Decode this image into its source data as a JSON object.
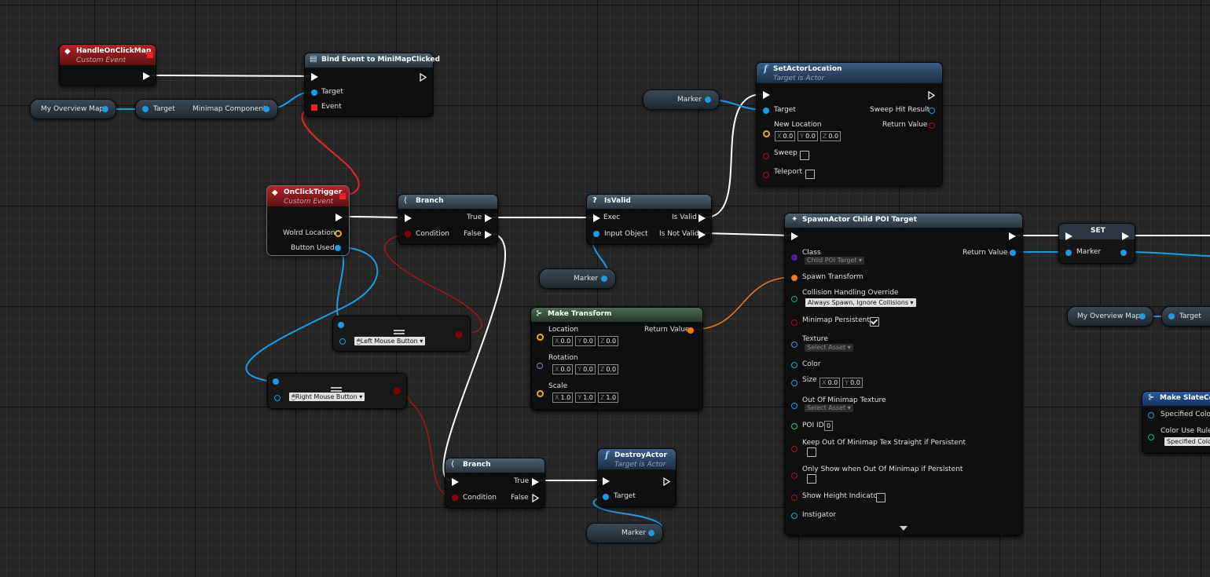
{
  "colors": {
    "exec": "#ffffff",
    "object": "#1e9be0",
    "boolean": "#a21818",
    "vector": "#e7b400",
    "transform": "#ef7a1a",
    "event_header": "#b62226",
    "function_header": "#3b5f86"
  },
  "handle_on_click": {
    "title": "HandleOnClickMap",
    "subtitle": "Custom Event"
  },
  "bind_event": {
    "title": "Bind Event to MiniMapClicked",
    "target": "Target",
    "event": "Event"
  },
  "overview_map_var": {
    "label": "My Overview Map"
  },
  "minimap_getter": {
    "target": "Target",
    "output": "Minimap Component"
  },
  "set_actor_location": {
    "title": "SetActorLocation",
    "subtitle": "Target is Actor",
    "target": "Target",
    "new_location": "New Location",
    "sweep": "Sweep",
    "teleport": "Teleport",
    "sweep_hit": "Sweep Hit Result",
    "return_value": "Return Value",
    "x": "0.0",
    "y": "0.0",
    "z": "0.0"
  },
  "marker_var_1": {
    "label": "Marker"
  },
  "on_click_trigger": {
    "title": "OnClickTrigger",
    "subtitle": "Custom Event",
    "world_location": "Wolrd Location",
    "button_used": "Button Used"
  },
  "branch_1": {
    "title": "Branch",
    "condition": "Condition",
    "true": "True",
    "false": "False"
  },
  "is_valid": {
    "title": "IsValid",
    "exec": "Exec",
    "input": "Input Object",
    "is_valid": "Is Valid",
    "is_not_valid": "Is Not Valid"
  },
  "marker_var_2": {
    "label": "Marker"
  },
  "spawn_actor": {
    "title": "SpawnActor Child POI Target",
    "class": "Class",
    "class_value": "Child POI Target",
    "return_value": "Return Value",
    "spawn_transform": "Spawn Transform",
    "collision": "Collision Handling Override",
    "collision_value": "Always Spawn, Ignore Collisions",
    "minimap_persistent": "Minimap Persistent",
    "texture": "Texture",
    "select_asset": "Select Asset",
    "color": "Color",
    "size": "Size",
    "size_x": "0.0",
    "size_y": "0.0",
    "out_texture": "Out Of Minimap Texture",
    "poi_id": "POI ID",
    "poi_id_value": "0",
    "keep_out": "Keep Out Of Minimap Tex Straight if Persistent",
    "only_show": "Only Show when Out Of Minimap if Persistent",
    "show_height": "Show Height Indicator",
    "instigator": "Instigator"
  },
  "set_node": {
    "title": "SET",
    "marker": "Marker"
  },
  "overview_map_var_2": {
    "label": "My Overview Map",
    "target": "Target"
  },
  "make_slate": {
    "title": "Make SlateColo",
    "specified": "Specified Color",
    "rule": "Color Use Rule",
    "rule_value": "Specified Colo"
  },
  "equal_left": {
    "value": "Left Mouse Button"
  },
  "equal_right": {
    "value": "Right Mouse Button"
  },
  "make_transform": {
    "title": "Make Transform",
    "location": "Location",
    "rotation": "Rotation",
    "scale": "Scale",
    "return_value": "Return Value",
    "loc": [
      "0.0",
      "0.0",
      "0.0"
    ],
    "rot": [
      "0.0",
      "0.0",
      "0.0"
    ],
    "scl": [
      "1.0",
      "1.0",
      "1.0"
    ]
  },
  "branch_2": {
    "title": "Branch",
    "condition": "Condition",
    "true": "True",
    "false": "False"
  },
  "destroy_actor": {
    "title": "DestroyActor",
    "subtitle": "Target is Actor",
    "target": "Target"
  },
  "marker_var_3": {
    "label": "Marker"
  },
  "axis": {
    "x": "X",
    "y": "Y",
    "z": "Z"
  }
}
